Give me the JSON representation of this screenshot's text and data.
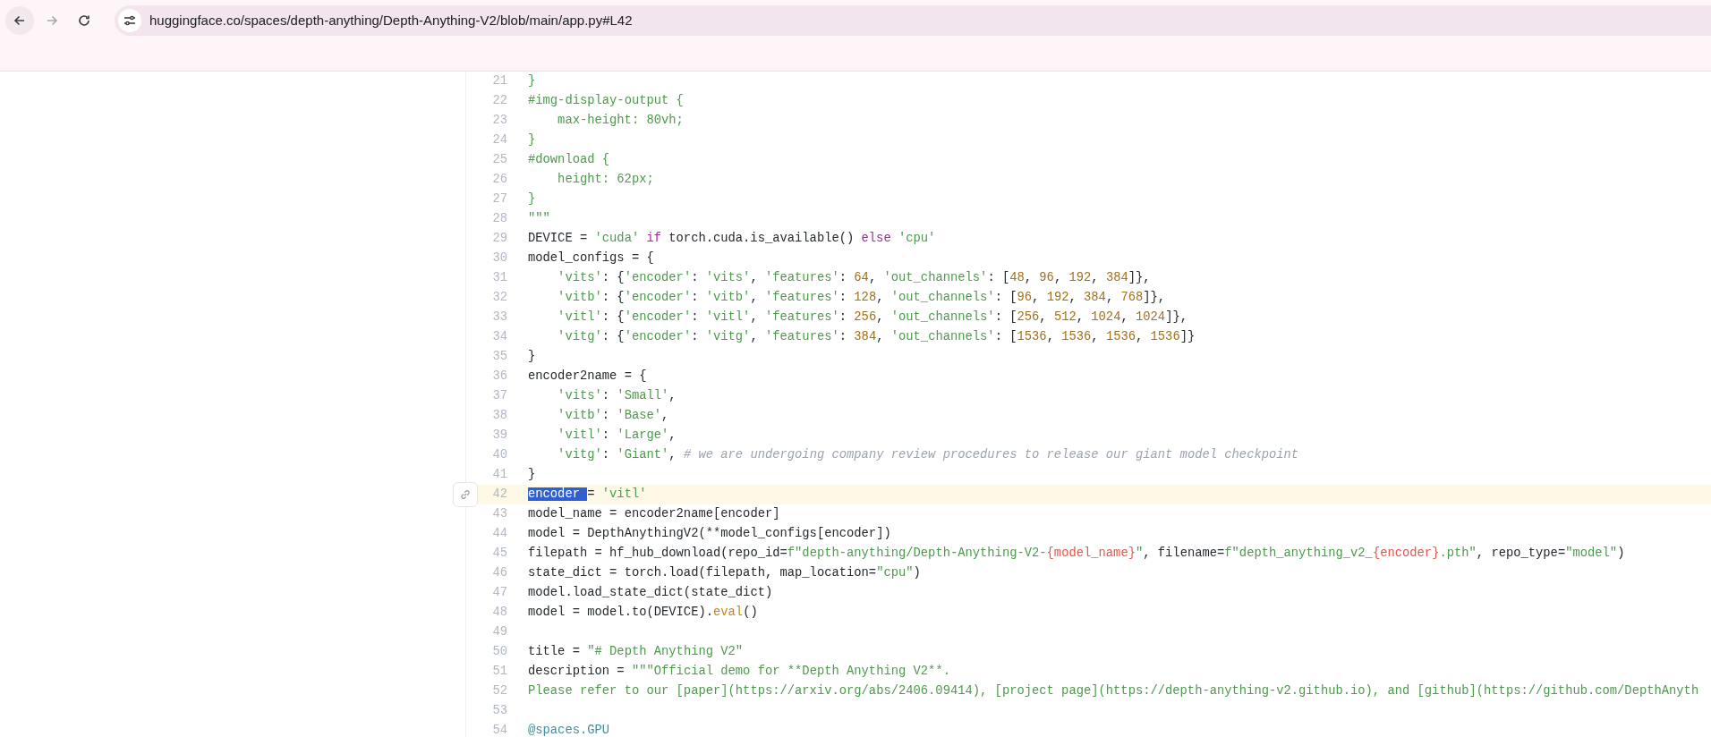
{
  "browser": {
    "url": "huggingface.co/spaces/depth-anything/Depth-Anything-V2/blob/main/app.py#L42",
    "forward_disabled": true
  },
  "code": {
    "lines": [
      {
        "number": "21",
        "selected": false,
        "indented": false,
        "tokens": [
          {
            "text": "}",
            "kind": "string"
          }
        ]
      },
      {
        "number": "22",
        "selected": false,
        "indented": false,
        "tokens": [
          {
            "text": "#img-display-output {",
            "kind": "string"
          }
        ]
      },
      {
        "number": "23",
        "selected": false,
        "indented": true,
        "tokens": [
          {
            "text": "max-height: 80vh;",
            "kind": "string"
          }
        ]
      },
      {
        "number": "24",
        "selected": false,
        "indented": false,
        "tokens": [
          {
            "text": "}",
            "kind": "string"
          }
        ]
      },
      {
        "number": "25",
        "selected": false,
        "indented": false,
        "tokens": [
          {
            "text": "#download {",
            "kind": "string"
          }
        ]
      },
      {
        "number": "26",
        "selected": false,
        "indented": true,
        "tokens": [
          {
            "text": "height: 62px;",
            "kind": "string"
          }
        ]
      },
      {
        "number": "27",
        "selected": false,
        "indented": false,
        "tokens": [
          {
            "text": "}",
            "kind": "string"
          }
        ]
      },
      {
        "number": "28",
        "selected": false,
        "indented": false,
        "tokens": [
          {
            "text": "\"\"\"",
            "kind": "string"
          }
        ]
      },
      {
        "number": "29",
        "selected": false,
        "indented": false,
        "tokens": [
          {
            "text": "DEVICE = ",
            "kind": "plain"
          },
          {
            "text": "'cuda'",
            "kind": "string"
          },
          {
            "text": "if",
            "kind": "keyword"
          },
          {
            "text": "torch.cuda.is_available()",
            "kind": "plain"
          },
          {
            "text": "else",
            "kind": "keyword"
          },
          {
            "text": "'cpu'",
            "kind": "string"
          }
        ]
      },
      {
        "number": "30",
        "selected": false,
        "indented": false,
        "tokens": [
          {
            "text": "model_configs = {",
            "kind": "plain"
          }
        ]
      },
      {
        "number": "31",
        "selected": false,
        "indented": true,
        "tokens": [
          {
            "text": "'vits'",
            "kind": "string"
          },
          {
            "text": ": {",
            "kind": "plain"
          },
          {
            "text": "'encoder'",
            "kind": "string"
          },
          {
            "text": ": ",
            "kind": "plain"
          },
          {
            "text": "'vits'",
            "kind": "string"
          },
          {
            "text": ", ",
            "kind": "plain"
          },
          {
            "text": "'features'",
            "kind": "string"
          },
          {
            "text": ": ",
            "kind": "plain"
          },
          {
            "text": "64",
            "kind": "number"
          },
          {
            "text": ", ",
            "kind": "plain"
          },
          {
            "text": "'out_channels'",
            "kind": "string"
          },
          {
            "text": ": [",
            "kind": "plain"
          },
          {
            "text": "48",
            "kind": "number"
          },
          {
            "text": ", ",
            "kind": "plain"
          },
          {
            "text": "96",
            "kind": "number"
          },
          {
            "text": ", ",
            "kind": "plain"
          },
          {
            "text": "192",
            "kind": "number"
          },
          {
            "text": ", ",
            "kind": "plain"
          },
          {
            "text": "384",
            "kind": "number"
          },
          {
            "text": "]},",
            "kind": "plain"
          }
        ]
      },
      {
        "number": "32",
        "selected": false,
        "indented": true,
        "tokens": [
          {
            "text": "'vitb'",
            "kind": "string"
          },
          {
            "text": ": {",
            "kind": "plain"
          },
          {
            "text": "'encoder'",
            "kind": "string"
          },
          {
            "text": ": ",
            "kind": "plain"
          },
          {
            "text": "'vitb'",
            "kind": "string"
          },
          {
            "text": ", ",
            "kind": "plain"
          },
          {
            "text": "'features'",
            "kind": "string"
          },
          {
            "text": ": ",
            "kind": "plain"
          },
          {
            "text": "128",
            "kind": "number"
          },
          {
            "text": ", ",
            "kind": "plain"
          },
          {
            "text": "'out_channels'",
            "kind": "string"
          },
          {
            "text": ": [",
            "kind": "plain"
          },
          {
            "text": "96",
            "kind": "number"
          },
          {
            "text": ", ",
            "kind": "plain"
          },
          {
            "text": "192",
            "kind": "number"
          },
          {
            "text": ", ",
            "kind": "plain"
          },
          {
            "text": "384",
            "kind": "number"
          },
          {
            "text": ", ",
            "kind": "plain"
          },
          {
            "text": "768",
            "kind": "number"
          },
          {
            "text": "]},",
            "kind": "plain"
          }
        ]
      },
      {
        "number": "33",
        "selected": false,
        "indented": true,
        "tokens": [
          {
            "text": "'vitl'",
            "kind": "string"
          },
          {
            "text": ": {",
            "kind": "plain"
          },
          {
            "text": "'encoder'",
            "kind": "string"
          },
          {
            "text": ": ",
            "kind": "plain"
          },
          {
            "text": "'vitl'",
            "kind": "string"
          },
          {
            "text": ", ",
            "kind": "plain"
          },
          {
            "text": "'features'",
            "kind": "string"
          },
          {
            "text": ": ",
            "kind": "plain"
          },
          {
            "text": "256",
            "kind": "number"
          },
          {
            "text": ", ",
            "kind": "plain"
          },
          {
            "text": "'out_channels'",
            "kind": "string"
          },
          {
            "text": ": [",
            "kind": "plain"
          },
          {
            "text": "256",
            "kind": "number"
          },
          {
            "text": ", ",
            "kind": "plain"
          },
          {
            "text": "512",
            "kind": "number"
          },
          {
            "text": ", ",
            "kind": "plain"
          },
          {
            "text": "1024",
            "kind": "number"
          },
          {
            "text": ", ",
            "kind": "plain"
          },
          {
            "text": "1024",
            "kind": "number"
          },
          {
            "text": "]},",
            "kind": "plain"
          }
        ]
      },
      {
        "number": "34",
        "selected": false,
        "indented": true,
        "tokens": [
          {
            "text": "'vitg'",
            "kind": "string"
          },
          {
            "text": ": {",
            "kind": "plain"
          },
          {
            "text": "'encoder'",
            "kind": "string"
          },
          {
            "text": ": ",
            "kind": "plain"
          },
          {
            "text": "'vitg'",
            "kind": "string"
          },
          {
            "text": ", ",
            "kind": "plain"
          },
          {
            "text": "'features'",
            "kind": "string"
          },
          {
            "text": ": ",
            "kind": "plain"
          },
          {
            "text": "384",
            "kind": "number"
          },
          {
            "text": ", ",
            "kind": "plain"
          },
          {
            "text": "'out_channels'",
            "kind": "string"
          },
          {
            "text": ": [",
            "kind": "plain"
          },
          {
            "text": "1536",
            "kind": "number"
          },
          {
            "text": ", ",
            "kind": "plain"
          },
          {
            "text": "1536",
            "kind": "number"
          },
          {
            "text": ", ",
            "kind": "plain"
          },
          {
            "text": "1536",
            "kind": "number"
          },
          {
            "text": ", ",
            "kind": "plain"
          },
          {
            "text": "1536",
            "kind": "number"
          },
          {
            "text": "]}",
            "kind": "plain"
          }
        ]
      },
      {
        "number": "35",
        "selected": false,
        "indented": false,
        "tokens": [
          {
            "text": "}",
            "kind": "plain"
          }
        ]
      },
      {
        "number": "36",
        "selected": false,
        "indented": false,
        "tokens": [
          {
            "text": "encoder2name = {",
            "kind": "plain"
          }
        ]
      },
      {
        "number": "37",
        "selected": false,
        "indented": true,
        "tokens": [
          {
            "text": "'vits'",
            "kind": "string"
          },
          {
            "text": ": ",
            "kind": "plain"
          },
          {
            "text": "'Small'",
            "kind": "string"
          },
          {
            "text": ",",
            "kind": "plain"
          }
        ]
      },
      {
        "number": "38",
        "selected": false,
        "indented": true,
        "tokens": [
          {
            "text": "'vitb'",
            "kind": "string"
          },
          {
            "text": ": ",
            "kind": "plain"
          },
          {
            "text": "'Base'",
            "kind": "string"
          },
          {
            "text": ",",
            "kind": "plain"
          }
        ]
      },
      {
        "number": "39",
        "selected": false,
        "indented": true,
        "tokens": [
          {
            "text": "'vitl'",
            "kind": "string"
          },
          {
            "text": ": ",
            "kind": "plain"
          },
          {
            "text": "'Large'",
            "kind": "string"
          },
          {
            "text": ",",
            "kind": "plain"
          }
        ]
      },
      {
        "number": "40",
        "selected": false,
        "indented": true,
        "tokens": [
          {
            "text": "'vitg'",
            "kind": "string"
          },
          {
            "text": ": ",
            "kind": "plain"
          },
          {
            "text": "'Giant'",
            "kind": "string"
          },
          {
            "text": ", ",
            "kind": "plain"
          },
          {
            "text": "# we are undergoing company review procedures to release our giant model checkpoint",
            "kind": "comment"
          }
        ]
      },
      {
        "number": "41",
        "selected": false,
        "indented": false,
        "tokens": [
          {
            "text": "}",
            "kind": "plain"
          }
        ]
      },
      {
        "number": "42",
        "selected": true,
        "indented": false,
        "tokens": [
          {
            "text": "encoder ",
            "kind": "selection"
          },
          {
            "text": "= ",
            "kind": "plain"
          },
          {
            "text": "'vitl'",
            "kind": "string"
          }
        ]
      },
      {
        "number": "43",
        "selected": false,
        "indented": false,
        "tokens": [
          {
            "text": "model_name = encoder2name[encoder]",
            "kind": "plain"
          }
        ]
      },
      {
        "number": "44",
        "selected": false,
        "indented": false,
        "tokens": [
          {
            "text": "model = DepthAnythingV2(**model_configs[encoder])",
            "kind": "plain"
          }
        ]
      },
      {
        "number": "45",
        "selected": false,
        "indented": false,
        "tokens": [
          {
            "text": "filepath = hf_hub_download(repo_id=",
            "kind": "plain"
          },
          {
            "text": "f\"depth-anything/Depth-Anything-V2-",
            "kind": "string"
          },
          {
            "text": "{model_name}",
            "kind": "interpolation"
          },
          {
            "text": "\"",
            "kind": "string"
          },
          {
            "text": ", filename=",
            "kind": "plain"
          },
          {
            "text": "f\"depth_anything_v2_",
            "kind": "string"
          },
          {
            "text": "{encoder}",
            "kind": "interpolation"
          },
          {
            "text": ".pth\"",
            "kind": "string"
          },
          {
            "text": ", repo_type=",
            "kind": "plain"
          },
          {
            "text": "\"model\"",
            "kind": "string"
          },
          {
            "text": ")",
            "kind": "plain"
          }
        ]
      },
      {
        "number": "46",
        "selected": false,
        "indented": false,
        "tokens": [
          {
            "text": "state_dict = torch.load(filepath, map_location=",
            "kind": "plain"
          },
          {
            "text": "\"cpu\"",
            "kind": "string"
          },
          {
            "text": ")",
            "kind": "plain"
          }
        ]
      },
      {
        "number": "47",
        "selected": false,
        "indented": false,
        "tokens": [
          {
            "text": "model.load_state_dict(state_dict)",
            "kind": "plain"
          }
        ]
      },
      {
        "number": "48",
        "selected": false,
        "indented": false,
        "tokens": [
          {
            "text": "model = model.to(DEVICE).",
            "kind": "plain"
          },
          {
            "text": "eval",
            "kind": "builtin"
          },
          {
            "text": "()",
            "kind": "plain"
          }
        ]
      },
      {
        "number": "49",
        "selected": false
      },
      {
        "number": "50",
        "selected": false,
        "indented": false,
        "tokens": [
          {
            "text": "title = ",
            "kind": "plain"
          },
          {
            "text": "\"# Depth Anything V2\"",
            "kind": "string"
          }
        ]
      },
      {
        "number": "51",
        "selected": false,
        "indented": false,
        "tokens": [
          {
            "text": "description = ",
            "kind": "plain"
          },
          {
            "text": "\"\"\"Official demo for **Depth Anything V2**.",
            "kind": "string"
          }
        ]
      },
      {
        "number": "52",
        "selected": false,
        "indented": false,
        "tokens": [
          {
            "text": "Please refer to our [paper](https://arxiv.org/abs/2406.09414), [project page](https://depth-anything-v2.github.io), and [github](https://github.com/DepthAnyth",
            "kind": "string"
          }
        ]
      },
      {
        "number": "53",
        "selected": false
      },
      {
        "number": "54",
        "selected": false,
        "indented": false,
        "tokens": [
          {
            "text": "@spaces.GPU",
            "kind": "decorator"
          }
        ]
      }
    ]
  }
}
